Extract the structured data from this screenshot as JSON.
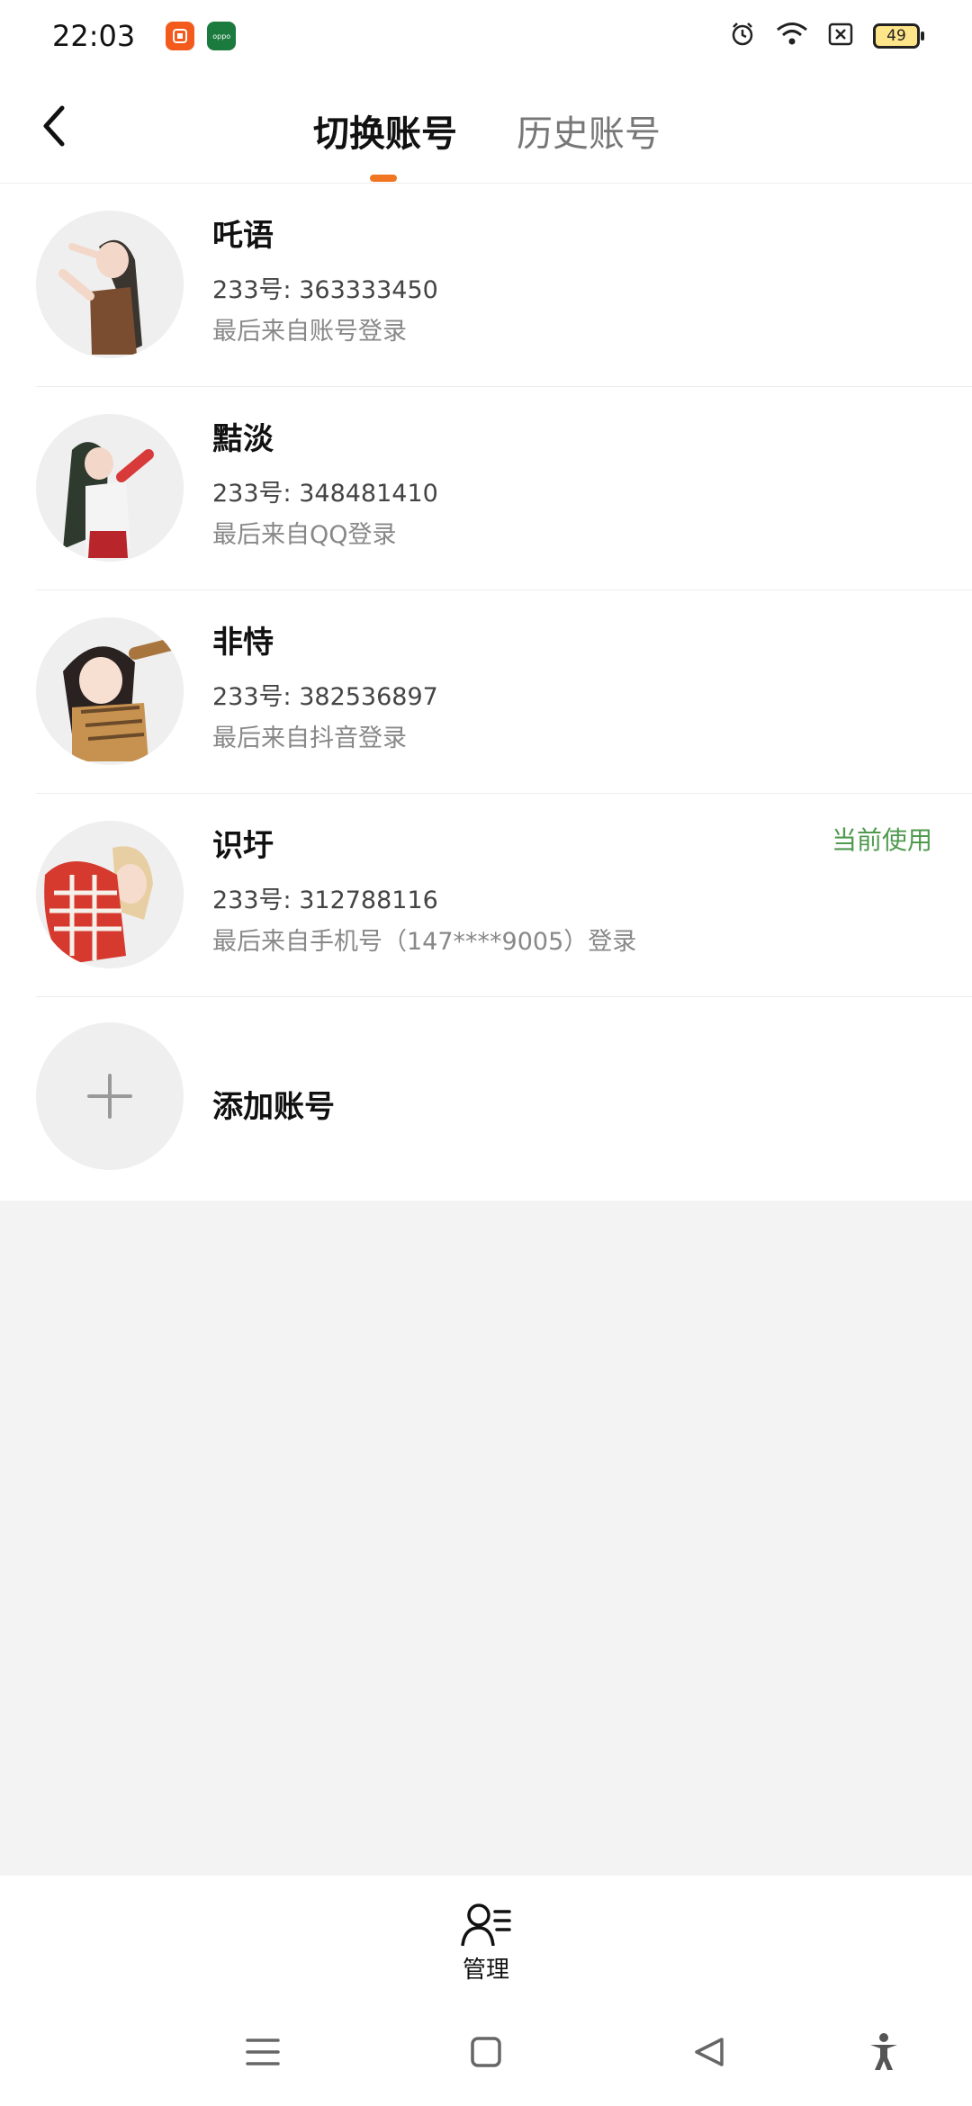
{
  "status_bar": {
    "time": "22:03",
    "app_badges": [
      "xiaohongshu-app-icon",
      "oppo-app-icon"
    ],
    "oppo_label": "oppo",
    "battery": "49"
  },
  "header": {
    "tabs": [
      {
        "label": "切换账号",
        "active": true
      },
      {
        "label": "历史账号",
        "active": false
      }
    ]
  },
  "accounts": [
    {
      "name": "吒语",
      "id": "233号: 363333450",
      "source": "最后来自账号登录",
      "current": ""
    },
    {
      "name": "黠淡",
      "id": "233号: 348481410",
      "source": "最后来自QQ登录",
      "current": ""
    },
    {
      "name": "非恃",
      "id": "233号: 382536897",
      "source": "最后来自抖音登录",
      "current": ""
    },
    {
      "name": "识圩",
      "id": "233号: 312788116",
      "source": "最后来自手机号（147****9005）登录",
      "current": "当前使用"
    }
  ],
  "add_account": {
    "label": "添加账号"
  },
  "bottom_bar": {
    "manage_label": "管理"
  },
  "colors": {
    "accent": "#f07622",
    "current_green": "#4f9a4f",
    "background": "#f3f3f3"
  }
}
